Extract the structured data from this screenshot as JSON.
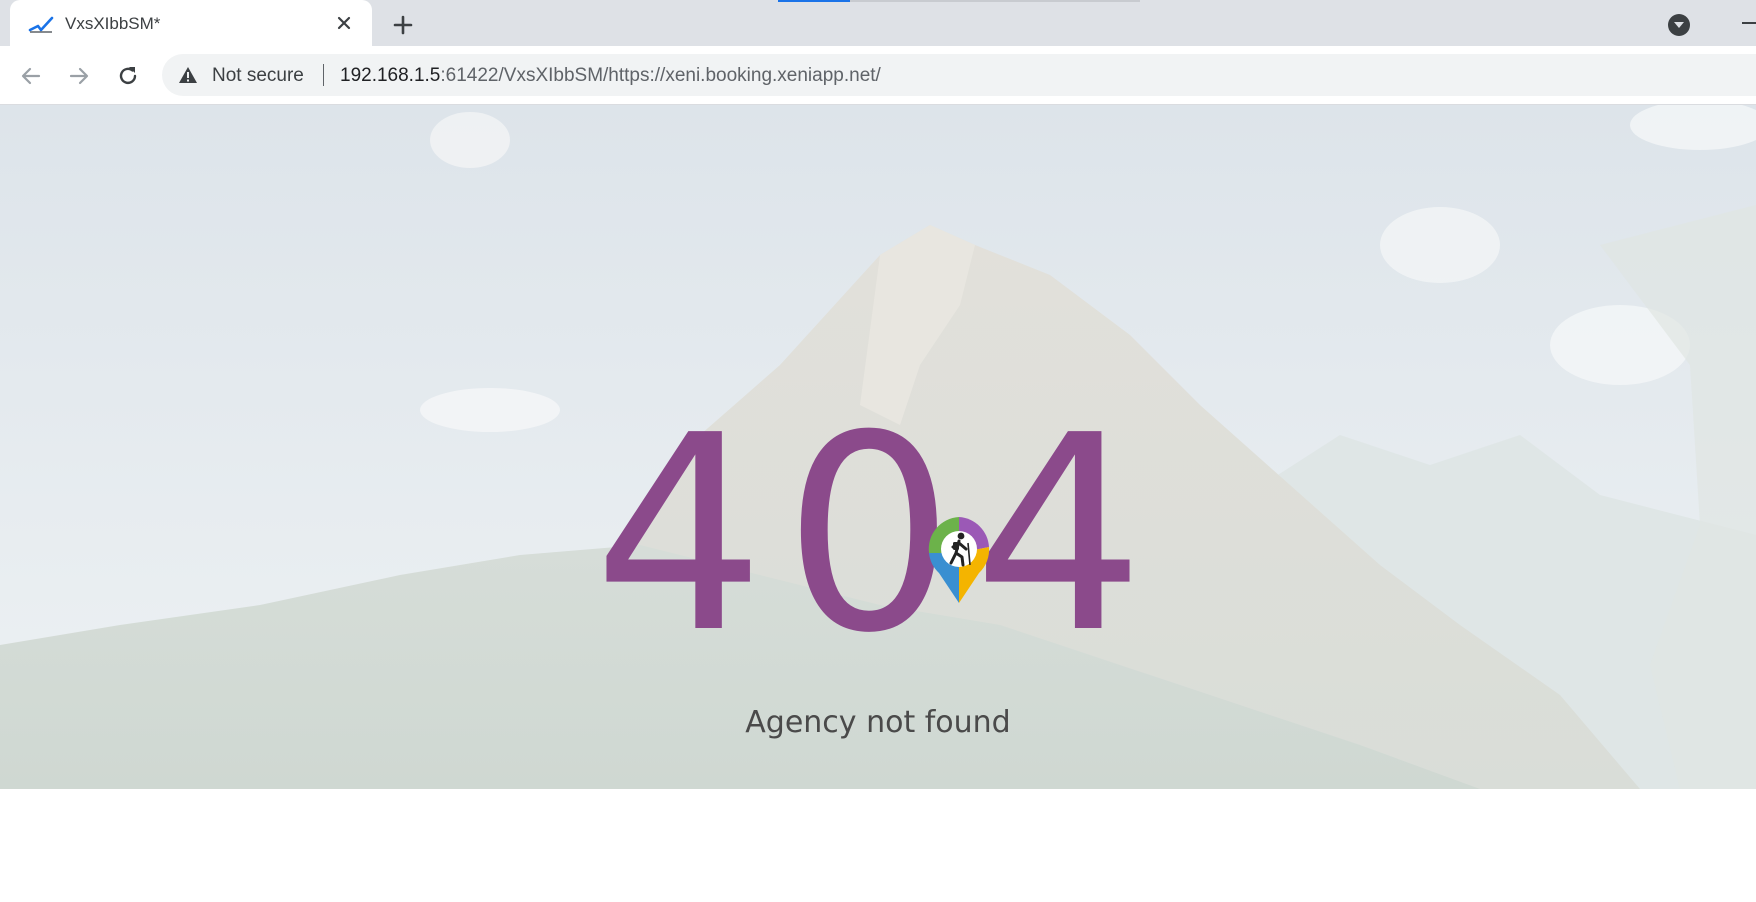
{
  "browser": {
    "tab": {
      "title": "VxsXIbbSM*",
      "favicon": "check-chart-icon"
    },
    "new_tab_icon": "plus-icon",
    "profile_icon": "profile-dropdown-icon",
    "nav": {
      "back_icon": "arrow-left-icon",
      "forward_icon": "arrow-right-icon",
      "reload_icon": "reload-icon"
    },
    "omnibox": {
      "security_label": "Not secure",
      "url_host": "192.168.1.5",
      "url_rest": ":61422/VxsXIbbSM/https://xeni.booking.xeniapp.net/"
    }
  },
  "page": {
    "error_digits": [
      "4",
      "0",
      "4"
    ],
    "message": "Agency not found",
    "logo": "hiker-map-pin-logo",
    "colors": {
      "digits": "#8b4a8b",
      "message": "#4a4a4a",
      "accent_blue": "#1a73e8"
    }
  }
}
